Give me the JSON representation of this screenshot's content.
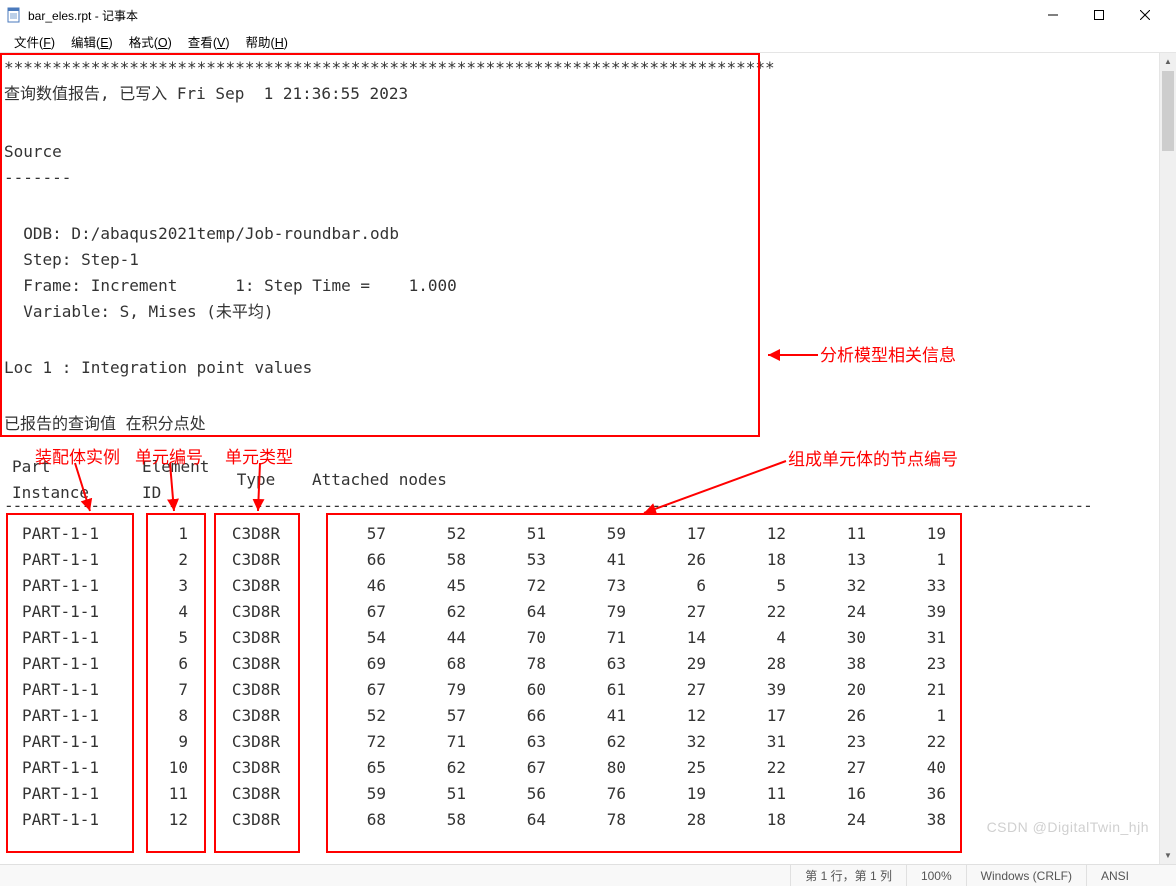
{
  "titlebar": {
    "filename": "bar_eles.rpt",
    "appname": "记事本"
  },
  "menu": {
    "file": {
      "label": "文件",
      "key": "F"
    },
    "edit": {
      "label": "编辑",
      "key": "E"
    },
    "format": {
      "label": "格式",
      "key": "O"
    },
    "view": {
      "label": "查看",
      "key": "V"
    },
    "help": {
      "label": "帮助",
      "key": "H"
    }
  },
  "report": {
    "stars": "********************************************************************************",
    "header": "查询数值报告, 已写入 Fri Sep  1 21:36:55 2023",
    "source_title": "Source",
    "source_dashes": "-------",
    "odb": "  ODB: D:/abaqus2021temp/Job-roundbar.odb",
    "step": "  Step: Step-1",
    "frame": "  Frame: Increment      1: Step Time =    1.000",
    "variable": "  Variable: S, Mises (未平均)",
    "loc": "Loc 1 : Integration point values",
    "reported": "已报告的查询值 在积分点处"
  },
  "table": {
    "headers": {
      "part": "Part Instance",
      "eid": "Element ID",
      "type": "Type",
      "nodes": "Attached nodes"
    },
    "dashes": "------------------------------------------------------------------------------------------------------------------------------",
    "rows": [
      {
        "part": "PART-1-1",
        "eid": "1",
        "type": "C3D8R",
        "nodes": [
          "57",
          "52",
          "51",
          "59",
          "17",
          "12",
          "11",
          "19"
        ]
      },
      {
        "part": "PART-1-1",
        "eid": "2",
        "type": "C3D8R",
        "nodes": [
          "66",
          "58",
          "53",
          "41",
          "26",
          "18",
          "13",
          "1"
        ]
      },
      {
        "part": "PART-1-1",
        "eid": "3",
        "type": "C3D8R",
        "nodes": [
          "46",
          "45",
          "72",
          "73",
          "6",
          "5",
          "32",
          "33"
        ]
      },
      {
        "part": "PART-1-1",
        "eid": "4",
        "type": "C3D8R",
        "nodes": [
          "67",
          "62",
          "64",
          "79",
          "27",
          "22",
          "24",
          "39"
        ]
      },
      {
        "part": "PART-1-1",
        "eid": "5",
        "type": "C3D8R",
        "nodes": [
          "54",
          "44",
          "70",
          "71",
          "14",
          "4",
          "30",
          "31"
        ]
      },
      {
        "part": "PART-1-1",
        "eid": "6",
        "type": "C3D8R",
        "nodes": [
          "69",
          "68",
          "78",
          "63",
          "29",
          "28",
          "38",
          "23"
        ]
      },
      {
        "part": "PART-1-1",
        "eid": "7",
        "type": "C3D8R",
        "nodes": [
          "67",
          "79",
          "60",
          "61",
          "27",
          "39",
          "20",
          "21"
        ]
      },
      {
        "part": "PART-1-1",
        "eid": "8",
        "type": "C3D8R",
        "nodes": [
          "52",
          "57",
          "66",
          "41",
          "12",
          "17",
          "26",
          "1"
        ]
      },
      {
        "part": "PART-1-1",
        "eid": "9",
        "type": "C3D8R",
        "nodes": [
          "72",
          "71",
          "63",
          "62",
          "32",
          "31",
          "23",
          "22"
        ]
      },
      {
        "part": "PART-1-1",
        "eid": "10",
        "type": "C3D8R",
        "nodes": [
          "65",
          "62",
          "67",
          "80",
          "25",
          "22",
          "27",
          "40"
        ]
      },
      {
        "part": "PART-1-1",
        "eid": "11",
        "type": "C3D8R",
        "nodes": [
          "59",
          "51",
          "56",
          "76",
          "19",
          "11",
          "16",
          "36"
        ]
      },
      {
        "part": "PART-1-1",
        "eid": "12",
        "type": "C3D8R",
        "nodes": [
          "68",
          "58",
          "64",
          "78",
          "28",
          "18",
          "24",
          "38"
        ]
      }
    ]
  },
  "annotations": {
    "model_info": "分析模型相关信息",
    "part_instance": "装配体实例",
    "element_id": "单元编号",
    "element_type": "单元类型",
    "attached_nodes": "组成单元体的节点编号"
  },
  "statusbar": {
    "position": "第 1 行，第 1 列",
    "zoom": "100%",
    "lineend": "Windows (CRLF)",
    "encoding": "ANSI"
  },
  "watermark": "CSDN @DigitalTwin_hjh"
}
